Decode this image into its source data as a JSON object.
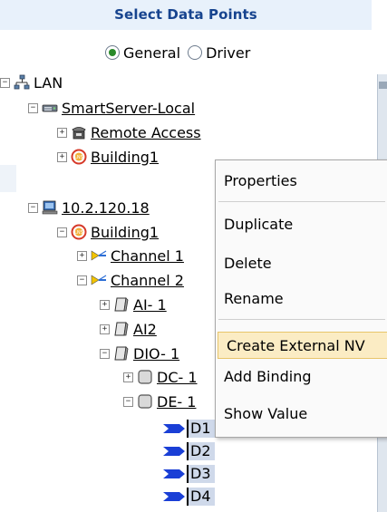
{
  "header": {
    "title": "Select Data Points"
  },
  "radio": {
    "options": [
      {
        "label": "General",
        "checked": true
      },
      {
        "label": "Driver",
        "checked": false
      }
    ]
  },
  "tree": {
    "lan": "LAN",
    "smartserver_local": "SmartServer-Local",
    "remote_access": "Remote Access",
    "building1_a": "Building1",
    "ip": "10.2.120.18",
    "building1_b": "Building1",
    "channel1": "Channel 1",
    "channel2": "Channel 2",
    "ai1": "AI- 1",
    "ai2": "AI2",
    "dio1": "DIO- 1",
    "dc1": "DC- 1",
    "de1": "DE- 1",
    "d1": "D1",
    "d2": "D2",
    "d3": "D3",
    "d4": "D4",
    "expander_plus": "+",
    "expander_minus": "−"
  },
  "menu": {
    "items": [
      "Properties",
      "Duplicate",
      "Delete",
      "Rename",
      "Create External NV",
      "Add Binding",
      "Show Value"
    ],
    "highlighted": "Create External NV"
  },
  "colors": {
    "header_bg": "#e8f1fb",
    "header_text": "#17448f",
    "selection_bg": "#cfd9ea",
    "menu_highlight": "#fbecc4"
  }
}
